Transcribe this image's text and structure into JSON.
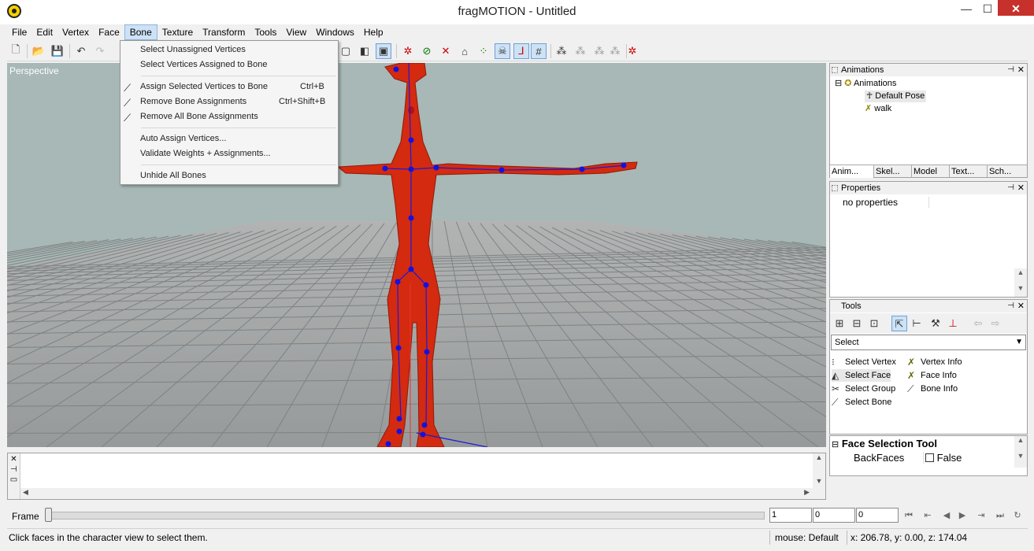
{
  "window": {
    "title": "fragMOTION - Untitled",
    "minimize": "—",
    "maximize": "☐",
    "close": "✕"
  },
  "menu": [
    "File",
    "Edit",
    "Vertex",
    "Face",
    "Bone",
    "Texture",
    "Transform",
    "Tools",
    "View",
    "Windows",
    "Help"
  ],
  "bone_menu": {
    "items": [
      {
        "label": "Select Unassigned Vertices",
        "shortcut": ""
      },
      {
        "label": "Select Vertices Assigned to Bone",
        "shortcut": ""
      },
      {
        "label": "Assign Selected Vertices to Bone",
        "shortcut": "Ctrl+B"
      },
      {
        "label": "Remove Bone Assignments",
        "shortcut": "Ctrl+Shift+B"
      },
      {
        "label": "Remove All Bone Assignments",
        "shortcut": ""
      },
      {
        "label": "Auto Assign Vertices...",
        "shortcut": ""
      },
      {
        "label": "Validate Weights + Assignments...",
        "shortcut": ""
      },
      {
        "label": "Unhide All Bones",
        "shortcut": ""
      }
    ]
  },
  "viewport": {
    "label": "Perspective",
    "background": "#a7b8b6",
    "model_color": "#d42a10",
    "bone_color": "#1a1ad8"
  },
  "animations_panel": {
    "title": "Animations",
    "tree": {
      "root": "Animations",
      "children": [
        "Default Pose",
        "walk"
      ]
    },
    "tabs": [
      "Anim...",
      "Skel...",
      "Model",
      "Text...",
      "Sch..."
    ]
  },
  "properties_panel": {
    "title": "Properties",
    "empty_text": "no properties"
  },
  "tools_panel": {
    "title": "Tools",
    "select_value": "Select",
    "links_left": [
      "Select Vertex",
      "Select Face",
      "Select Group",
      "Select Bone"
    ],
    "links_right": [
      "Vertex Info",
      "Face Info",
      "Bone Info"
    ]
  },
  "face_selection_tool": {
    "title": "Face Selection Tool",
    "prop_name": "BackFaces",
    "prop_value": "False"
  },
  "timeline": {
    "label": "Frame",
    "frame": "1",
    "start": "0",
    "end": "0"
  },
  "status": {
    "message": "Click faces in the character view to select them.",
    "mouse_mode": "mouse: Default",
    "coords": "x: 206.78, y: 0.00, z: 174.04"
  }
}
